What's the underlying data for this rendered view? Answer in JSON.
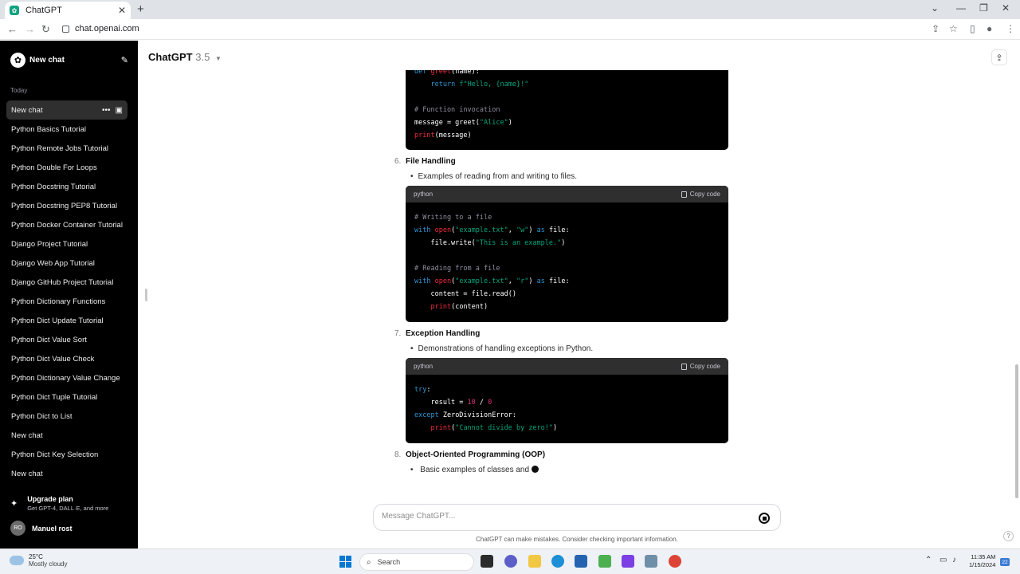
{
  "browser": {
    "tab_title": "ChatGPT",
    "url": "chat.openai.com",
    "new_tab": "+",
    "tab_close": "✕"
  },
  "sidebar": {
    "new_chat_label": "New chat",
    "section_today": "Today",
    "chats": [
      "New chat",
      "Python Basics Tutorial",
      "Python Remote Jobs Tutorial",
      "Python Double For Loops",
      "Python Docstring Tutorial",
      "Python Docstring PEP8 Tutorial",
      "Python Docker Container Tutorial",
      "Django Project Tutorial",
      "Django Web App Tutorial",
      "Django GitHub Project Tutorial",
      "Python Dictionary Functions",
      "Python Dict Update Tutorial",
      "Python Dict Value Sort",
      "Python Dict Value Check",
      "Python Dictionary Value Change",
      "Python Dict Tuple Tutorial",
      "Python Dict to List",
      "New chat",
      "Python Dict Key Selection",
      "New chat"
    ],
    "upgrade_title": "Upgrade plan",
    "upgrade_sub": "Get GPT-4, DALL·E, and more",
    "user_initials": "RO",
    "user_name": "Manuel rost"
  },
  "header": {
    "model_name": "ChatGPT",
    "model_version": "3.5"
  },
  "content": {
    "sections": [
      {
        "number": "6.",
        "title": "File Handling",
        "bullet": "Examples of reading from and writing to files."
      },
      {
        "number": "7.",
        "title": "Exception Handling",
        "bullet": "Demonstrations of handling exceptions in Python."
      },
      {
        "number": "8.",
        "title": "Object-Oriented Programming (OOP)",
        "bullet": "Basic examples of classes and"
      }
    ],
    "code_lang": "python",
    "copy_label": "Copy code"
  },
  "composer": {
    "placeholder": "Message ChatGPT...",
    "disclaimer": "ChatGPT can make mistakes. Consider checking important information.",
    "help": "?"
  },
  "taskbar": {
    "temperature": "25°C",
    "weather": "Mostly cloudy",
    "search": "Search",
    "time": "11:35 AM",
    "date": "1/15/2024",
    "notification_count": "22"
  }
}
